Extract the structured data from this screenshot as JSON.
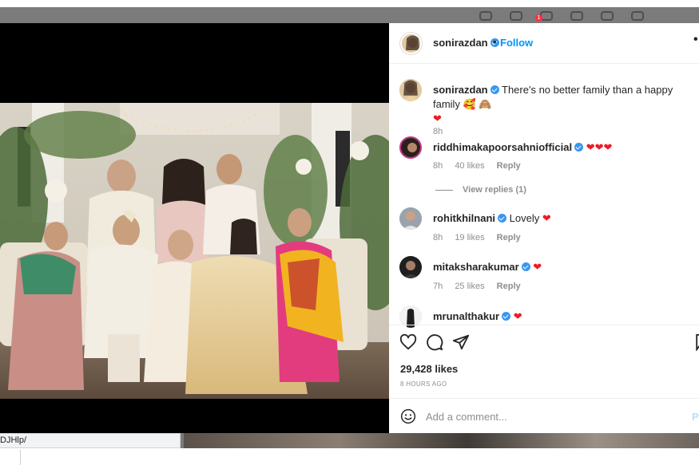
{
  "browser": {
    "url_hint": "DJHlp/"
  },
  "background": {
    "notification_count": "1"
  },
  "post": {
    "author": "sonirazdan",
    "follow_label": "Follow",
    "separator": "•",
    "more_label": "•",
    "caption": "There's no better family than a happy family",
    "caption_emoji": "🥰 🙈",
    "caption_heart": "❤",
    "caption_time": "8h",
    "likes": "29,428 likes",
    "time_ago": "8 HOURS AGO",
    "comment_placeholder": "Add a comment...",
    "post_label": "Post"
  },
  "comments": [
    {
      "user": "riddhimakapoorsahniofficial",
      "text": "",
      "hearts": "❤❤❤",
      "time": "8h",
      "likes": "40 likes",
      "reply": "Reply",
      "view_replies": "View replies (1)"
    },
    {
      "user": "rohitkhilnani",
      "text": "Lovely",
      "hearts": "❤",
      "time": "8h",
      "likes": "19 likes",
      "reply": "Reply"
    },
    {
      "user": "mitaksharakumar",
      "text": "",
      "hearts": "❤",
      "time": "7h",
      "likes": "25 likes",
      "reply": "Reply"
    },
    {
      "user": "mrunalthakur",
      "text": "",
      "hearts": "❤",
      "time": "",
      "likes": "",
      "reply": ""
    }
  ],
  "icons": {
    "like": "heart-outline-icon",
    "comment": "comment-bubble-icon",
    "share": "paper-plane-icon",
    "emoji": "smiley-icon"
  },
  "colors": {
    "link": "#0095f6",
    "verified": "#3897f0",
    "heart": "#ed1c24",
    "muted": "#8e8e8e"
  }
}
